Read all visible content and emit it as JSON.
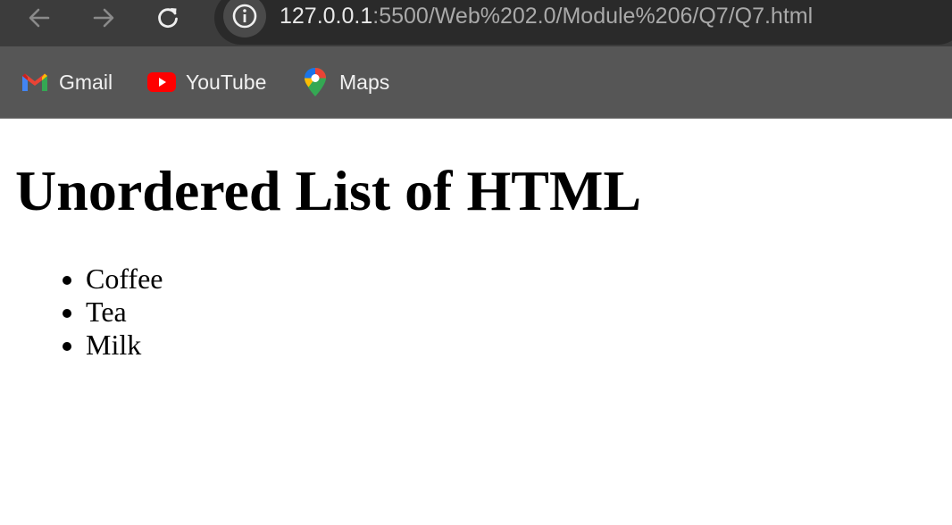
{
  "browser": {
    "url_host": "127.0.0.1",
    "url_path": ":5500/Web%202.0/Module%206/Q7/Q7.html",
    "bookmarks": [
      {
        "label": "Gmail",
        "icon": "gmail-icon"
      },
      {
        "label": "YouTube",
        "icon": "youtube-icon"
      },
      {
        "label": "Maps",
        "icon": "maps-icon"
      }
    ],
    "toolbar_colors": {
      "chrome_bg": "#3c3c3c",
      "omnibox_bg": "#2a2a2a",
      "bookmarks_bg": "#565656"
    }
  },
  "page": {
    "heading": "Unordered List of HTML",
    "list_items": [
      "Coffee",
      "Tea",
      "Milk"
    ]
  }
}
